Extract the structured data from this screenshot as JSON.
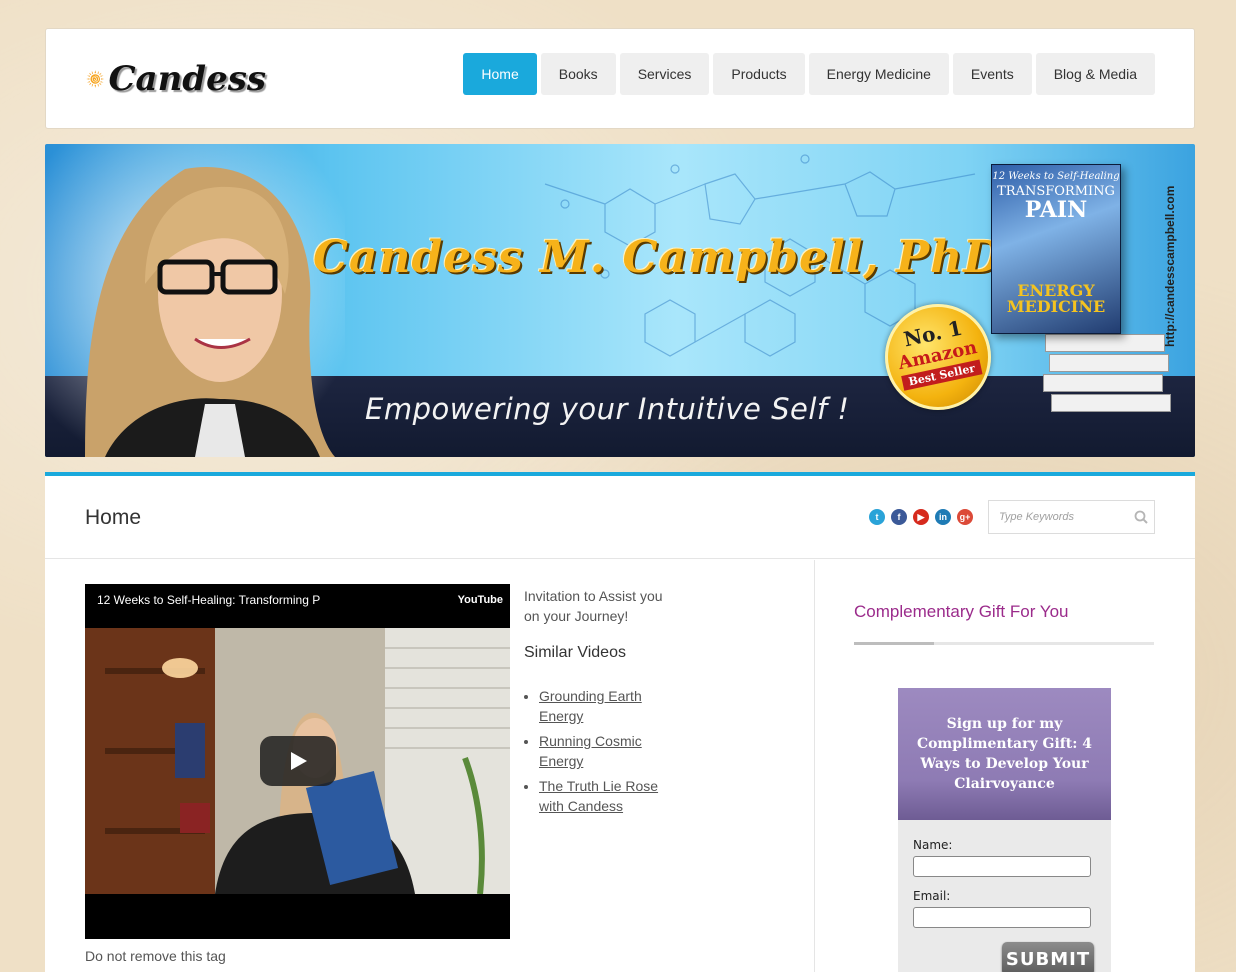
{
  "brand": {
    "name": "Candess"
  },
  "nav": {
    "items": [
      {
        "label": "Home",
        "active": true
      },
      {
        "label": "Books"
      },
      {
        "label": "Services"
      },
      {
        "label": "Products"
      },
      {
        "label": "Energy Medicine"
      },
      {
        "label": "Events"
      },
      {
        "label": "Blog & Media"
      }
    ],
    "active_color": "#1aa9dc"
  },
  "banner": {
    "name": "Candess M. Campbell, PhD",
    "tagline": "Empowering your Intuitive Self !",
    "url": "http://candesscampbell.com",
    "book": {
      "subtitle": "12 Weeks to Self-Healing",
      "title_line1": "TRANSFORMING",
      "title_line2": "PAIN",
      "title_line3": "ENERGY MEDICINE"
    },
    "badge": {
      "line1": "No. 1",
      "line2": "Amazon",
      "line3": "Best Seller"
    }
  },
  "page": {
    "title": "Home",
    "social": [
      "twitter-icon",
      "facebook-icon",
      "youtube-icon",
      "linkedin-icon",
      "googleplus-icon"
    ],
    "search_placeholder": "Type Keywords"
  },
  "video": {
    "title": "12 Weeks to Self-Healing: Transforming P",
    "provider": "YouTube",
    "caption": "Do not remove this tag"
  },
  "aside": {
    "invite": "Invitation to Assist you on your Journey!",
    "similar_heading": "Similar Videos",
    "similar_videos": [
      "Grounding Earth Energy",
      "Running Cosmic Energy",
      "The Truth Lie Rose with Candess"
    ]
  },
  "sidebar": {
    "gift_heading": "Complementary Gift For You",
    "signup_title": "Sign up for my Complimentary Gift: 4 Ways to Develop Your Clairvoyance",
    "name_label": "Name:",
    "email_label": "Email:",
    "submit_label": "SUBMIT"
  }
}
